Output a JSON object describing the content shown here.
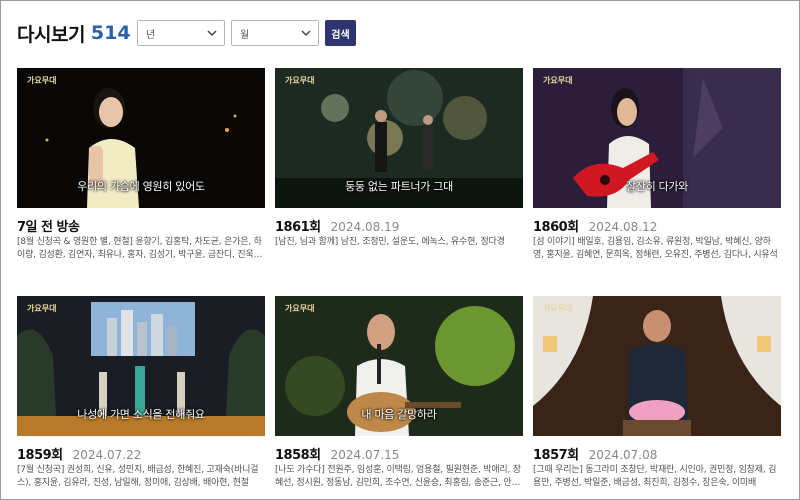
{
  "header": {
    "title": "다시보기",
    "count": "514"
  },
  "filters": {
    "year_label": "년",
    "month_label": "월",
    "search_label": "검색"
  },
  "cards": [
    {
      "episode": "7일 전 방송",
      "date": "",
      "desc": "[8월 신청곡 & 영원한 별, 현철] 윤향기, 김홍탁, 차도균, 은가은, 하이량, 김성환, 김연자, 최유나, 홍자, 김성기, 박구윤, 금잔디, 진욱, 정다한…",
      "subtitle": "우리의 가슴에 영원히 있어도"
    },
    {
      "episode": "1861회",
      "date": "2024.08.19",
      "desc": "[남진, 님과 함께] 남진, 조정민, 설운도, 에녹스, 유수현, 정다경",
      "subtitle": "둥둥 없는 파트너가 그대"
    },
    {
      "episode": "1860회",
      "date": "2024.08.12",
      "desc": "[섬 이야기] 배일호, 김용임, 김소유, 류원정, 박일남, 박혜신, 양하영, 홍지윤, 김혜연, 문희옥, 정해련, 오유진, 주병선, 김다나, 시유석",
      "subtitle": "잘잔히 다가와"
    },
    {
      "episode": "1859회",
      "date": "2024.07.22",
      "desc": "[7월 신청곡] 권성희, 신유, 성민지, 배금성, 한혜진, 고재숙(바니걸스), 홍지윤, 김유라, 진성, 남일해, 정미애, 김상배, 배아현, 현철",
      "subtitle": "나성에 가면 소식을 전해줘요"
    },
    {
      "episode": "1858회",
      "date": "2024.07.15",
      "desc": "[나도 가수다] 전원주, 임성훈, 이택림, 엄용철, 필원현준, 박애리, 장혜선, 정시원, 정동남, 김민희, 조수연, 신윤승, 최홍림, 송준근, 안소미, 박준…",
      "subtitle": "내 마음 갈망하라"
    },
    {
      "episode": "1857회",
      "date": "2024.07.08",
      "desc": "[그때 우리는] 동그라미 조창단, 박재란, 시인아, 권민정, 임창제, 김용만, 주병선, 박일준, 배금성, 최진희, 김정수, 장은숙, 이미배",
      "subtitle": ""
    }
  ],
  "logo_text": "가요무대"
}
